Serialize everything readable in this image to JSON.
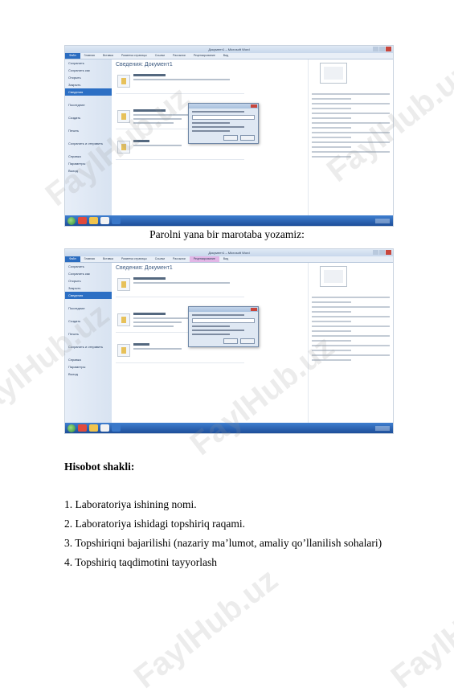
{
  "screenshots": [
    {
      "window_title": "Документ1 – Microsoft Word",
      "tabs": [
        "Файл",
        "Главная",
        "Вставка",
        "Разметка страницы",
        "Ссылки",
        "Рассылки",
        "Рецензирование",
        "Вид"
      ],
      "page_title": "Сведения: Документ1",
      "sidebar": [
        "Сохранить",
        "Сохранить как",
        "Открыть",
        "Закрыть",
        "Сведения",
        "Последние",
        "Создать",
        "Печать",
        "Сохранить и отправить",
        "Справка",
        "Параметры",
        "Выход"
      ],
      "dialog_title": "Шифрование документа"
    },
    {
      "window_title": "Документ1 – Microsoft Word",
      "tabs": [
        "Файл",
        "Главная",
        "Вставка",
        "Разметка страницы",
        "Ссылки",
        "Рассылки",
        "Рецензирование",
        "Вид"
      ],
      "page_title": "Сведения: Документ1",
      "sidebar": [
        "Сохранить",
        "Сохранить как",
        "Открыть",
        "Закрыть",
        "Сведения",
        "Последние",
        "Создать",
        "Печать",
        "Сохранить и отправить",
        "Справка",
        "Параметры",
        "Выход"
      ],
      "dialog_title": "Подтверждение пароля"
    }
  ],
  "caption": "Parolni yana bir marotaba yozamiz:",
  "report": {
    "heading": "Hisobot shakli:",
    "items": [
      "1. Laboratoriya ishining nomi.",
      "2. Laboratoriya ishidagi topshiriq raqami.",
      "3. Topshiriqni bajarilishi (nazariy ma’lumot, amaliy qo’llanilish sohalari)",
      "4. Topshiriq taqdimotini tayyorlash"
    ]
  },
  "watermark": "FaylHub.uz",
  "colors": {
    "ribbon_blue": "#2a6cc0",
    "taskbar": "#1d4e9a"
  }
}
